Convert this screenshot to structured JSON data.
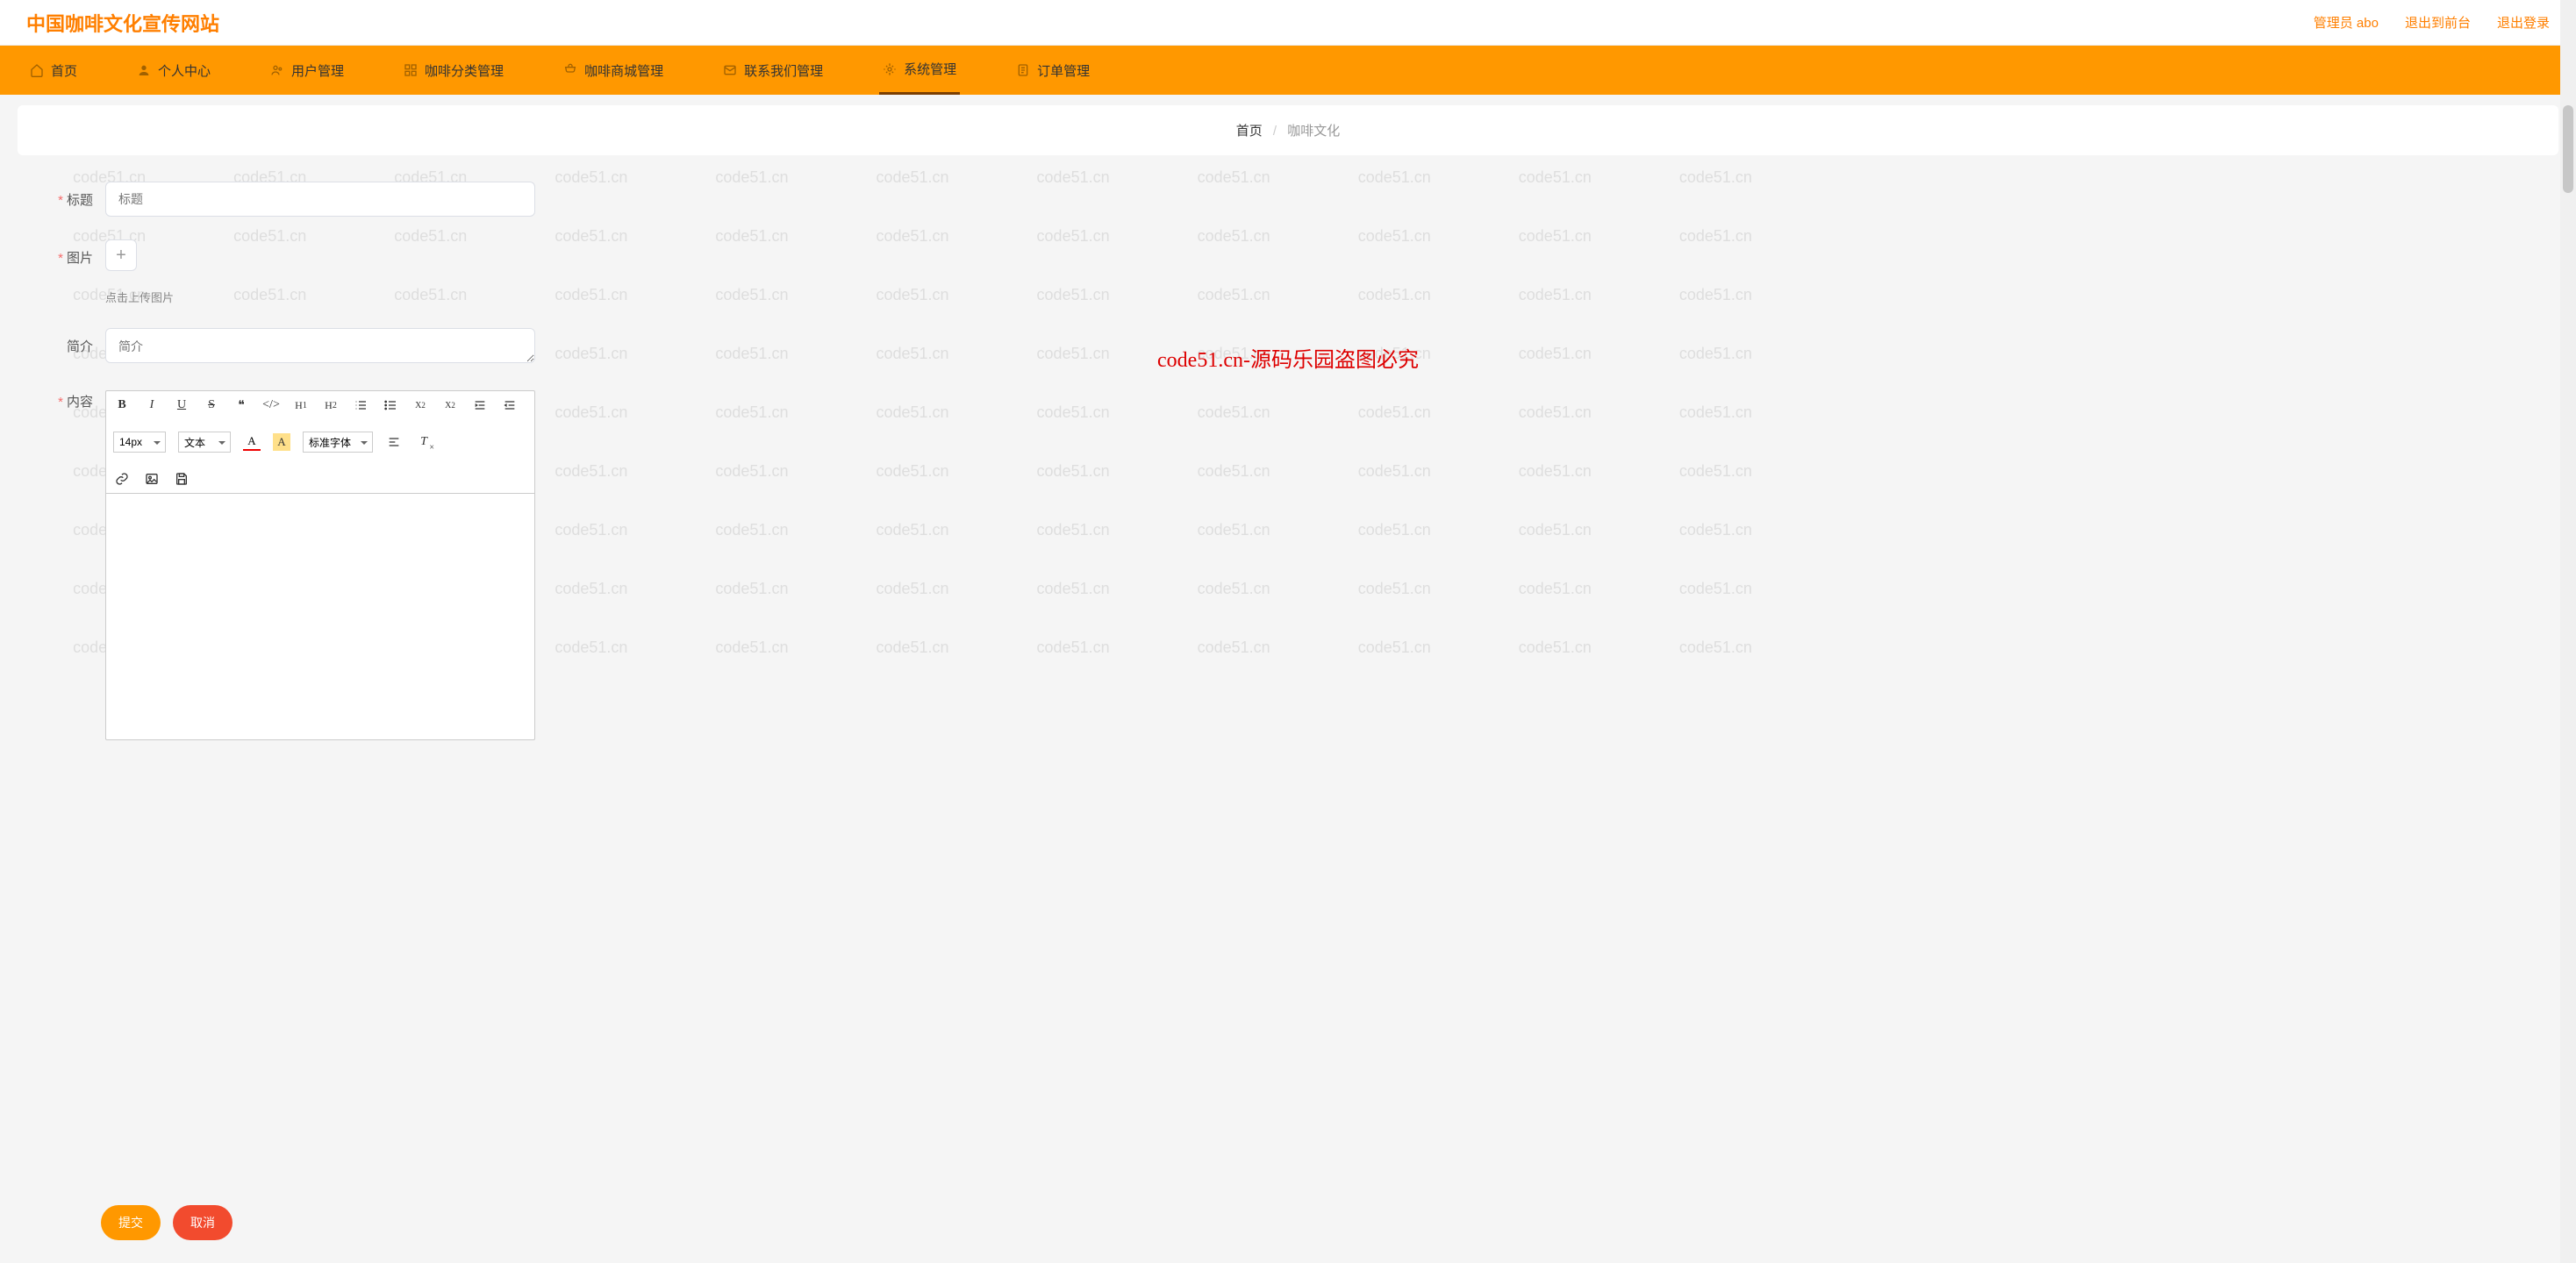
{
  "site_title": "中国咖啡文化宣传网站",
  "header_links": {
    "admin": "管理员 abo",
    "frontend": "退出到前台",
    "logout": "退出登录"
  },
  "nav": [
    {
      "label": "首页",
      "icon": "home-icon"
    },
    {
      "label": "个人中心",
      "icon": "user-icon"
    },
    {
      "label": "用户管理",
      "icon": "users-icon"
    },
    {
      "label": "咖啡分类管理",
      "icon": "category-icon"
    },
    {
      "label": "咖啡商城管理",
      "icon": "shop-icon"
    },
    {
      "label": "联系我们管理",
      "icon": "contact-icon"
    },
    {
      "label": "系统管理",
      "icon": "settings-icon",
      "active": true
    },
    {
      "label": "订单管理",
      "icon": "order-icon"
    }
  ],
  "breadcrumb": {
    "home": "首页",
    "current": "咖啡文化"
  },
  "form": {
    "title": {
      "label": "标题",
      "placeholder": "标题"
    },
    "image": {
      "label": "图片",
      "hint": "点击上传图片"
    },
    "summary": {
      "label": "简介",
      "placeholder": "简介"
    },
    "content": {
      "label": "内容"
    },
    "submit": "提交",
    "cancel": "取消"
  },
  "editor_toolbar": {
    "size": "14px",
    "text_type": "文本",
    "font": "标准字体"
  },
  "watermark_text": "code51.cn",
  "center_warning": "code51.cn-源码乐园盗图必究"
}
